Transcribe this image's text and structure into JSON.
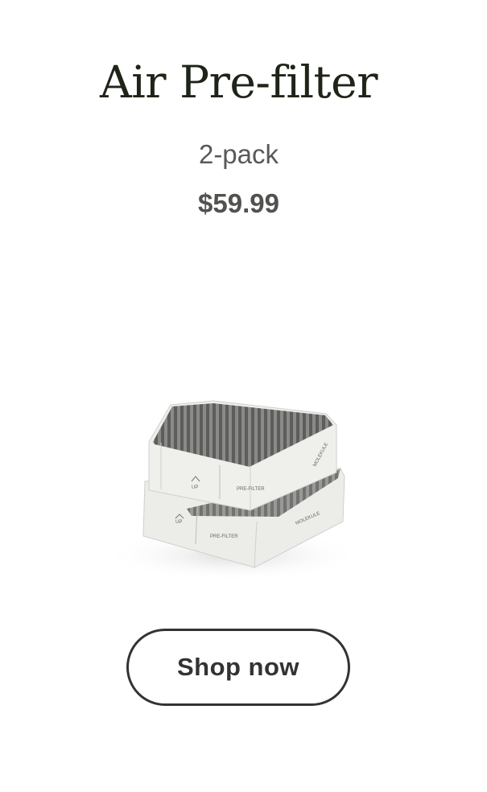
{
  "product": {
    "name": "Air Pre-filter",
    "variant": "2-pack",
    "price": "$59.99"
  },
  "image": {
    "top_filter_up_label": "UP",
    "top_filter_type_label": "PRE-FILTER",
    "top_filter_brand_label": "MOLEKULE",
    "bottom_filter_up_label": "UP",
    "bottom_filter_type_label": "PRE-FILTER",
    "bottom_filter_brand_label": "MOLEKULE"
  },
  "cta": {
    "label": "Shop now"
  },
  "colors": {
    "title": "#1e2418",
    "subtitle": "#595959",
    "price": "#4f524d",
    "button_border": "#333333",
    "filter_body": "#e9e9e7",
    "filter_mesh": "#6d6d6b"
  }
}
